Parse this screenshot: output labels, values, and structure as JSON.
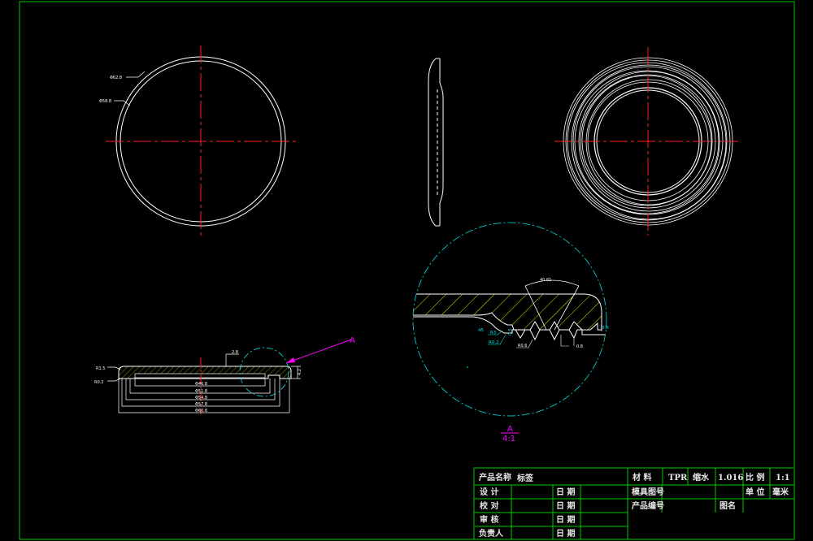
{
  "front_view": {
    "dim_outer": "Φ62.8",
    "dim_inner": "Φ58.8"
  },
  "section_view": {
    "radius_top": "R1.5",
    "radius_bottom": "R0.2",
    "thickness": "2.8",
    "height": "4.2",
    "dims": [
      "Φ46.8",
      "Φ51.8",
      "Φ54.8",
      "Φ57.8",
      "Φ60.6"
    ]
  },
  "detail_callout": {
    "label": "A"
  },
  "detail_view": {
    "angle": "40.61",
    "r3": "R3",
    "r02": "R0.2",
    "r06": "R0.6",
    "dim_45": "45",
    "dim_05": "0.5",
    "dim_06": "0.6",
    "dim_08": "0.8",
    "label": "A",
    "scale": "4:1"
  },
  "title_block": {
    "product_name_label": "产品名称",
    "product_name_value": "标签",
    "material_label": "材 料",
    "material_value": "TPR",
    "shrink_label": "缩水",
    "shrink_value": "1.016",
    "scale_label": "比 例",
    "scale_value": "1:1",
    "design_label": "设 计",
    "check_label": "校 对",
    "review_label": "审 核",
    "owner_label": "负责人",
    "date_label": "日 期",
    "mold_no_label": "模具图号",
    "unit_label": "单 位",
    "unit_value": "毫米",
    "product_no_label": "产品编号",
    "drawing_name_label": "图名"
  },
  "colors": {
    "frame": "#00c800",
    "line": "#ffffff",
    "center": "#ff2020",
    "cyan": "#00e6e6",
    "magenta": "#ff00ff",
    "hatch": "#e6e600"
  }
}
